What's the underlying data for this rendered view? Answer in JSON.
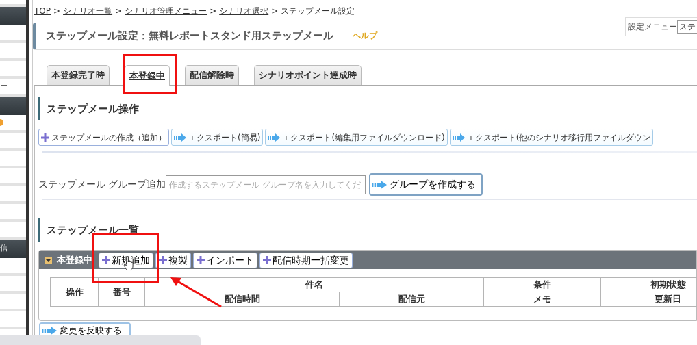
{
  "sidebar": {
    "items": [
      {
        "kind": "item"
      },
      {
        "kind": "header"
      },
      {
        "kind": "item"
      },
      {
        "kind": "item"
      },
      {
        "kind": "item"
      },
      {
        "kind": "item",
        "text": "ー"
      },
      {
        "kind": "header"
      },
      {
        "kind": "icon_item"
      },
      {
        "kind": "item"
      },
      {
        "kind": "item"
      },
      {
        "kind": "item"
      },
      {
        "kind": "item"
      },
      {
        "kind": "item"
      },
      {
        "kind": "item"
      },
      {
        "kind": "header",
        "text": "信"
      },
      {
        "kind": "item"
      },
      {
        "kind": "item"
      },
      {
        "kind": "item"
      },
      {
        "kind": "item"
      }
    ]
  },
  "breadcrumb": [
    {
      "label": "TOP",
      "kind": "link"
    },
    {
      "label": "シナリオ一覧",
      "kind": "link"
    },
    {
      "label": "シナリオ管理メニュー",
      "kind": "link"
    },
    {
      "label": "シナリオ選択",
      "kind": "link"
    },
    {
      "label": "ステップメール設定",
      "kind": "current"
    }
  ],
  "breadcrumb_separator": ">",
  "page_title": "ステップメール設定：無料レポートスタンド用ステップメール",
  "help_link": "ヘルプ",
  "settings_menu": {
    "label": "設定メニュー",
    "value": "ステ"
  },
  "tabs": [
    {
      "label": "本登録完了時",
      "selected": false
    },
    {
      "label": "本登録中",
      "selected": true
    },
    {
      "label": "配信解除時",
      "selected": false
    },
    {
      "label": "シナリオポイント達成時",
      "selected": false
    }
  ],
  "operations": {
    "heading": "ステップメール操作",
    "buttons": [
      {
        "kind": "plus",
        "label": "ステップメールの作成（追加）"
      },
      {
        "kind": "arrow",
        "label": "エクスポート(簡易)"
      },
      {
        "kind": "arrow",
        "label": "エクスポート(編集用ファイルダウンロード)"
      },
      {
        "kind": "arrow",
        "label": "エクスポート(他のシナリオ移行用ファイルダウン"
      }
    ]
  },
  "group_add": {
    "label": "ステップメール グループ追加",
    "placeholder": "作成するステップメール グループ名を入力してくだ",
    "button": "グループを作成する"
  },
  "list": {
    "heading": "ステップメール一覧",
    "group": {
      "name": "本登録中",
      "expanded": true,
      "buttons": [
        {
          "kind": "plus",
          "label": "新規追加"
        },
        {
          "kind": "plus",
          "label": "複製"
        },
        {
          "kind": "plus",
          "label": "インポート"
        },
        {
          "kind": "plus",
          "label": "配信時期一括変更"
        }
      ]
    },
    "table": {
      "columns": [
        {
          "label": "操作"
        },
        {
          "label": "番号"
        },
        {
          "label": "件名",
          "sub": [
            {
              "label": "配信時間"
            },
            {
              "label": "配信元"
            }
          ]
        },
        {
          "label": "条件",
          "sub": [
            {
              "label": "メモ"
            }
          ]
        },
        {
          "label": "初期状態",
          "sub": [
            {
              "label": "更新日"
            }
          ]
        }
      ]
    }
  },
  "apply_button": "変更を反映する"
}
